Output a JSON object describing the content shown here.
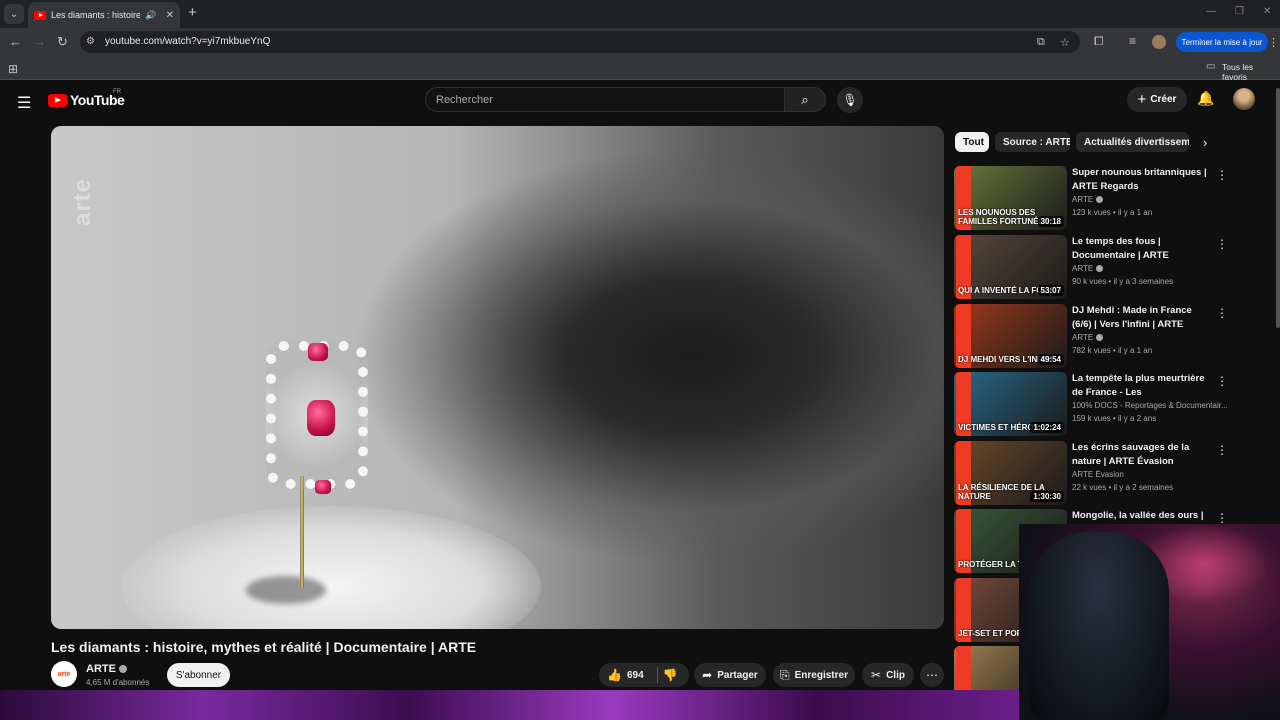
{
  "browser": {
    "tab_title": "Les diamants : histoire, mythes et réalité | Documentaire | ARTE",
    "url": "youtube.com/watch?v=yi7mkbueYnQ",
    "update_label": "Terminer la mise à jour",
    "bookmarks_label": "Tous les favoris"
  },
  "header": {
    "logo": "YouTube",
    "region": "FR",
    "search_placeholder": "Rechercher",
    "create_label": "Créer"
  },
  "video": {
    "watermark": "arte",
    "title": "Les diamants : histoire, mythes et réalité | Documentaire | ARTE",
    "channel": "ARTE",
    "channel_avatar_text": "arte",
    "subscribers": "4,65 M d'abonnés",
    "subscribe_label": "S'abonner",
    "likes": "694",
    "share_label": "Partager",
    "save_label": "Enregistrer",
    "clip_label": "Clip"
  },
  "sidebar": {
    "chips": [
      "Tout",
      "Source : ARTE",
      "Actualités divertissement"
    ],
    "recommendations": [
      {
        "title": "Super nounous britanniques | ARTE Regards",
        "channel": "ARTE",
        "views": "123 k vues",
        "age": "il y a 1 an",
        "duration": "30:18",
        "thumb_text": "Les nounous des familles fortunées",
        "color": "#6a7a3a"
      },
      {
        "title": "Le temps des fous | Documentaire | ARTE",
        "channel": "ARTE",
        "views": "90 k vues",
        "age": "il y a 3 semaines",
        "duration": "53:07",
        "thumb_text": "Qui a inventé la folie ?",
        "color": "#5a4a3a"
      },
      {
        "title": "DJ Mehdi : Made in France (6/6) | Vers l'infini | ARTE",
        "channel": "ARTE",
        "views": "782 k vues",
        "age": "il y a 1 an",
        "duration": "49:54",
        "thumb_text": "DJ Mehdi vers l'infini",
        "color": "#a03a1a"
      },
      {
        "title": "La tempête la plus meurtrière de France - Les conséquences...",
        "channel": "100% DOCS - Reportages & Documentair...",
        "views": "159 k vues",
        "age": "il y a 2 ans",
        "duration": "1:02:24",
        "thumb_text": "Victimes et héros",
        "color": "#2a6a8a"
      },
      {
        "title": "Les écrins sauvages de la nature | ARTE Évasion",
        "channel": "ARTE Évasion",
        "views": "22 k vues",
        "age": "il y a 2 semaines",
        "duration": "1:30:30",
        "thumb_text": "La résilience de la nature",
        "color": "#6a4a2a"
      },
      {
        "title": "Mongolie, la vallée des ours |",
        "channel": "",
        "views": "",
        "age": "",
        "duration": "",
        "thumb_text": "Protéger la taïga ro",
        "color": "#3a5a3a"
      },
      {
        "title": "",
        "channel": "",
        "views": "",
        "age": "",
        "duration": "",
        "thumb_text": "Jet-set et porno",
        "color": "#7a4a3a"
      },
      {
        "title": "",
        "channel": "",
        "views": "",
        "age": "",
        "duration": "",
        "thumb_text": "",
        "color": "#a08050"
      }
    ]
  }
}
